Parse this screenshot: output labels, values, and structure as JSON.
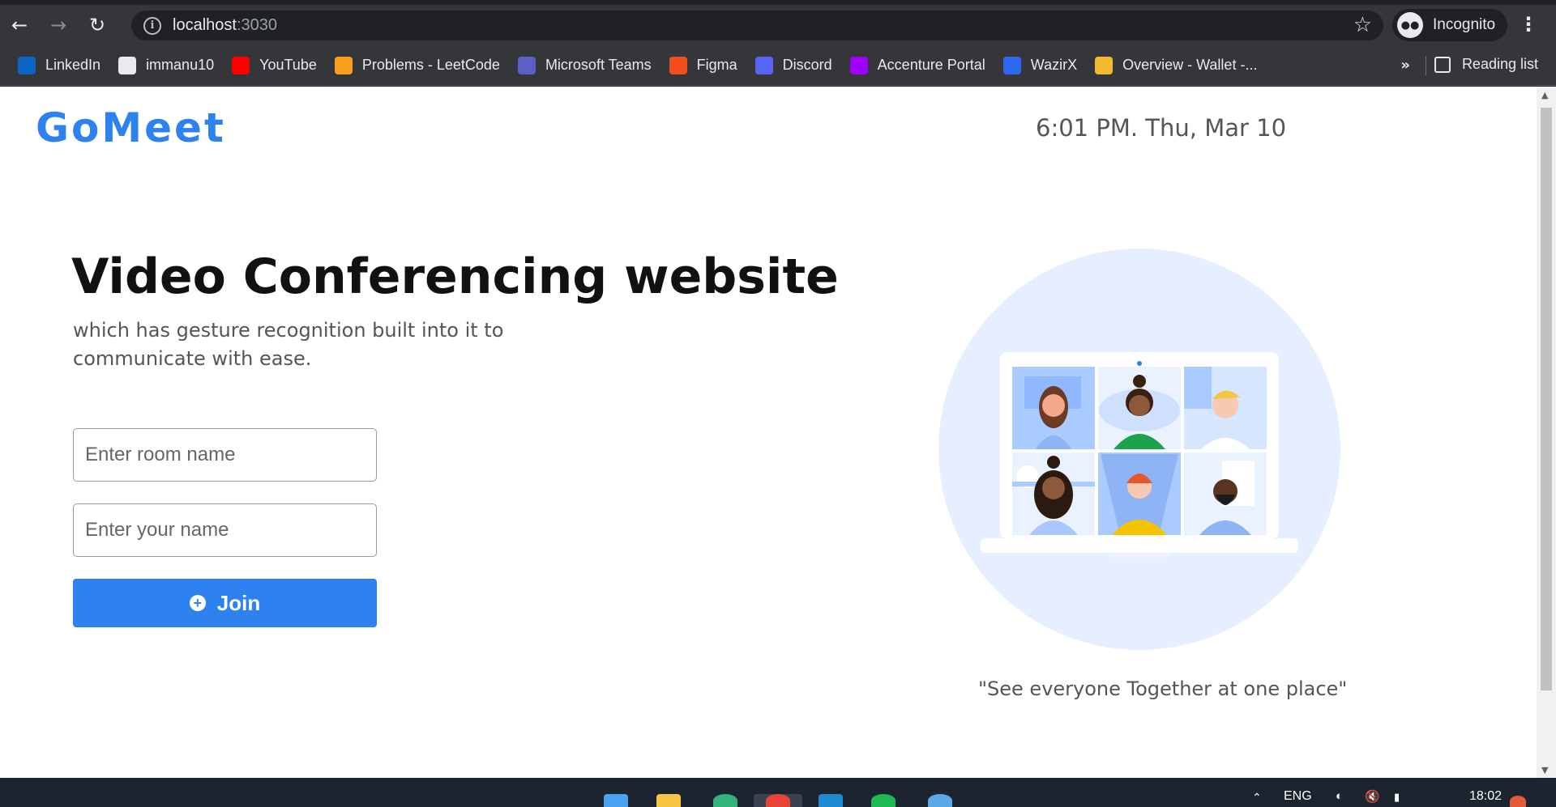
{
  "browser": {
    "url_host": "localhost",
    "url_port": ":3030",
    "profile_label": "Incognito",
    "bookmarks": [
      {
        "label": "LinkedIn",
        "icon": "linkedin-icon",
        "color": "#0a66c2"
      },
      {
        "label": "immanu10",
        "icon": "github-icon",
        "color": "#e8eaed"
      },
      {
        "label": "YouTube",
        "icon": "youtube-icon",
        "color": "#ff0000"
      },
      {
        "label": "Problems - LeetCode",
        "icon": "leetcode-icon",
        "color": "#f89f1b"
      },
      {
        "label": "Microsoft Teams",
        "icon": "teams-icon",
        "color": "#5b5fc7"
      },
      {
        "label": "Figma",
        "icon": "figma-icon",
        "color": "#f24e1e"
      },
      {
        "label": "Discord",
        "icon": "discord-icon",
        "color": "#5865f2"
      },
      {
        "label": "Accenture Portal",
        "icon": "accenture-icon",
        "color": "#a100ff"
      },
      {
        "label": "WazirX",
        "icon": "wazirx-icon",
        "color": "#3067f0"
      },
      {
        "label": "Overview - Wallet -...",
        "icon": "binance-icon",
        "color": "#f3ba2f"
      }
    ],
    "more_label": "»",
    "reading_list_label": "Reading list"
  },
  "page": {
    "logo": "GoMeet",
    "clock": "6:01 PM. Thu, Mar 10",
    "hero_title": "Video Conferencing website",
    "hero_subtitle": "which has gesture recognition built into it to communicate with ease.",
    "room_placeholder": "Enter room name",
    "name_placeholder": "Enter your name",
    "join_label": "Join",
    "caption": "\"See everyone Together at one place\"",
    "accent_color": "#2d82f0"
  },
  "taskbar": {
    "language": "ENG",
    "time": "18:02"
  }
}
